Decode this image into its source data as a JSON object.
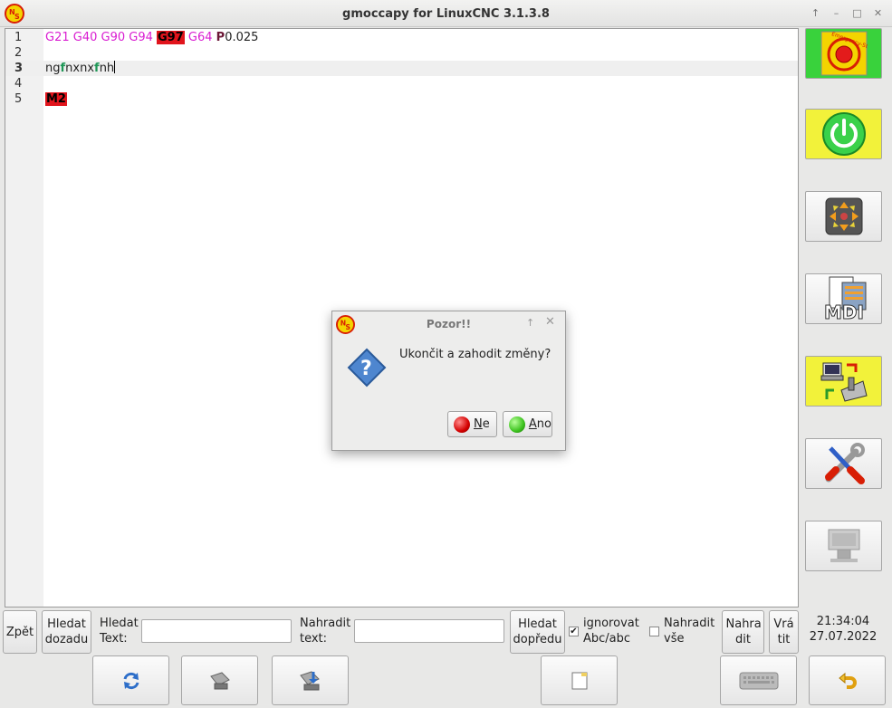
{
  "window": {
    "title": "gmoccapy for LinuxCNC  3.1.3.8",
    "controls": [
      "↑",
      "–",
      "□",
      "✕"
    ]
  },
  "editor": {
    "lines": [
      {
        "num": "1",
        "tokens": [
          {
            "t": "G21 G40 G90 G94 ",
            "c": "g"
          },
          {
            "t": "G97",
            "c": "hl"
          },
          {
            "t": " G64 ",
            "c": "g"
          },
          {
            "t": "P",
            "c": "p"
          },
          {
            "t": "0.025",
            "c": ""
          }
        ]
      },
      {
        "num": "2",
        "tokens": []
      },
      {
        "num": "3",
        "current": true,
        "tokens": [
          {
            "t": "ng",
            "c": ""
          },
          {
            "t": "f",
            "c": "fchar"
          },
          {
            "t": "nxnx",
            "c": ""
          },
          {
            "t": "f",
            "c": "fchar"
          },
          {
            "t": "nh",
            "c": ""
          }
        ]
      },
      {
        "num": "4",
        "tokens": []
      },
      {
        "num": "5",
        "tokens": [
          {
            "t": "M2",
            "c": "hl"
          }
        ]
      }
    ]
  },
  "right_panel": {
    "buttons": [
      {
        "name": "emergency-stop-button",
        "icon": "emergency-stop-icon",
        "color": "#39d23c",
        "label": "Emergency-Stop"
      },
      {
        "name": "machine-power-button",
        "icon": "power-icon",
        "color": "#f2f23a"
      },
      {
        "name": "manual-mode-button",
        "icon": "jog-arrows-icon"
      },
      {
        "name": "mdi-mode-button",
        "icon": "mdi-icon",
        "label": "MDI"
      },
      {
        "name": "auto-mode-button",
        "icon": "auto-machine-icon",
        "color": "#f2f23a"
      },
      {
        "name": "settings-button",
        "icon": "tools-icon"
      },
      {
        "name": "user-tabs-button",
        "icon": "user-tabs-icon"
      }
    ]
  },
  "search_bar": {
    "back_label": "Zpět",
    "search_back_label": "Hledat dozadu",
    "search_text_label": "Hledat Text:",
    "search_text_value": "",
    "replace_text_label": "Nahradit text:",
    "replace_text_value": "",
    "search_forward_label": "Hledat dopředu",
    "ignore_case_label": "ignorovat Abc/abc",
    "ignore_case_checked": "✔",
    "replace_all_label": "Nahradit vše",
    "replace_label": "Nahra dit",
    "undo_label": "Vrá tit"
  },
  "clock": {
    "time": "21:34:04",
    "date": "27.07.2022"
  },
  "bottom_bar": {
    "buttons": [
      {
        "name": "reload-button",
        "icon": "reload-icon"
      },
      {
        "name": "save-button",
        "icon": "save-icon"
      },
      {
        "name": "save-as-button",
        "icon": "save-as-icon"
      },
      {
        "name": "new-file-button",
        "icon": "new-file-icon"
      },
      {
        "name": "keyboard-button",
        "icon": "keyboard-icon"
      },
      {
        "name": "undo-exit-button",
        "icon": "return-arrow-icon"
      }
    ]
  },
  "dialog": {
    "title": "Pozor!!",
    "message": "Ukončit a zahodit změny?",
    "no_mnemonic": "N",
    "no_rest": "e",
    "yes_mnemonic": "A",
    "yes_rest": "no"
  },
  "colors": {
    "gcode": "#d91dd1",
    "highlight": "#e1141c",
    "parameter": "#6b1836",
    "green_btn": "#39d23c",
    "yellow_btn": "#f2f23a"
  }
}
